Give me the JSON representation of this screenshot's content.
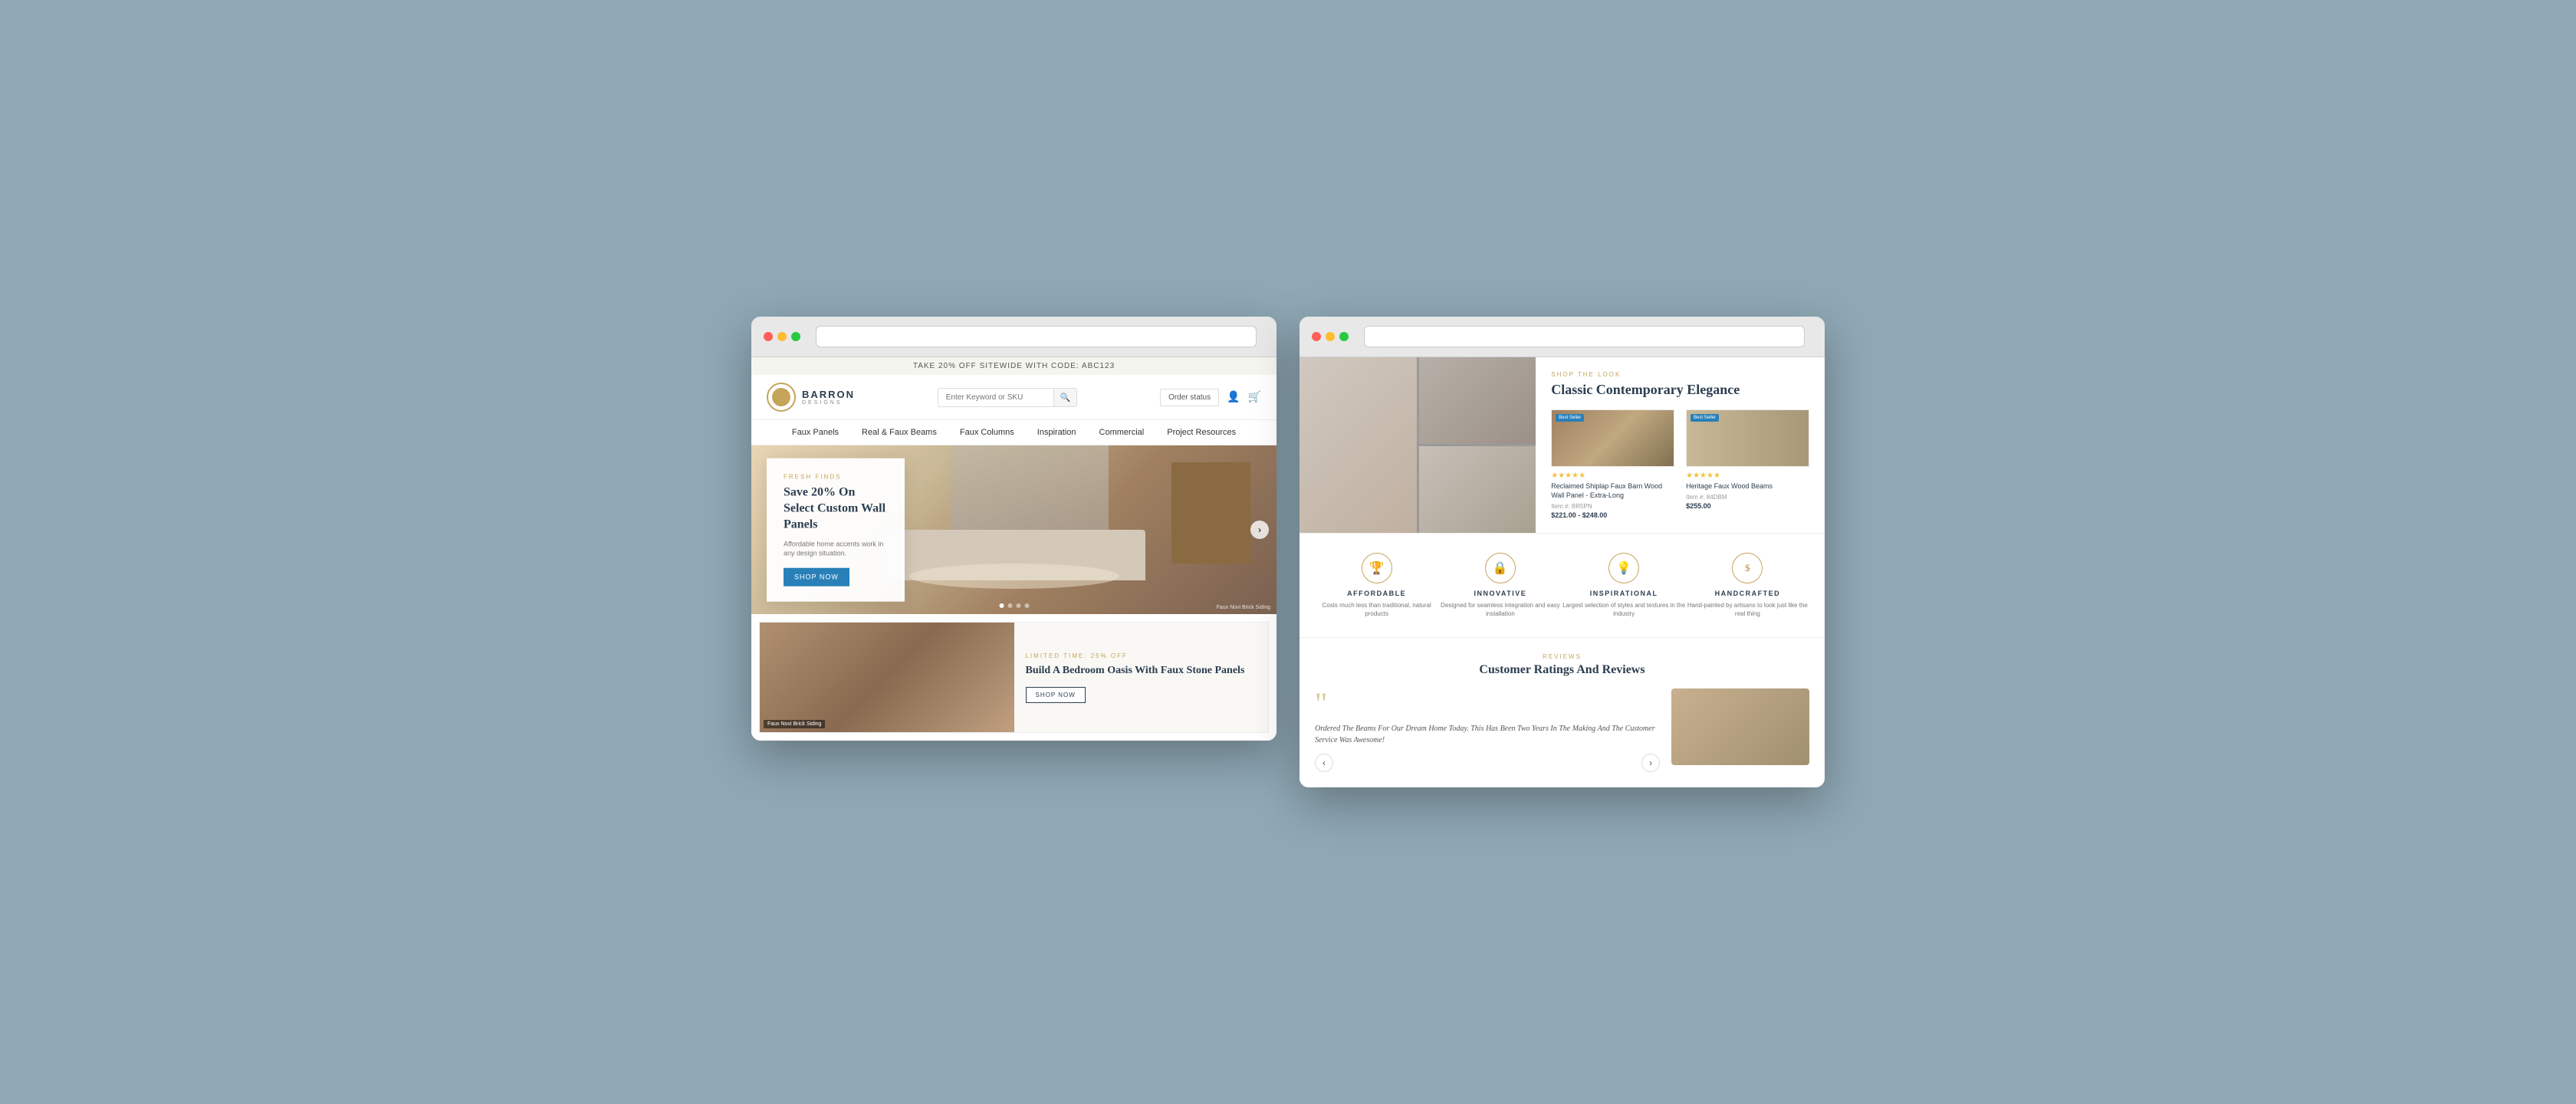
{
  "screen1": {
    "announcement": "TAKE 20% OFF SITEWIDE WITH CODE: ABC123",
    "logo": {
      "brand": "BARRON",
      "sub": "DESIGNS"
    },
    "search": {
      "placeholder": "Enter Keyword or SKU"
    },
    "order_status_label": "Order status",
    "nav_items": [
      "Faux Panels",
      "Real & Faux Beams",
      "Faux Columns",
      "Inspiration",
      "Commercial",
      "Project Resources"
    ],
    "hero": {
      "tag": "FRESH FINDS",
      "title": "Save 20% On Select Custom Wall Panels",
      "desc": "Affordable home accents work in any design situation.",
      "btn": "SHOP NOW",
      "caption": "Faux Novi Brick Siding",
      "dots": [
        true,
        false,
        false,
        false
      ]
    },
    "promo": {
      "tag": "LIMITED TIME: 25% OFF",
      "title": "Build A Bedroom Oasis With Faux Stone Panels",
      "btn": "SHOP NOW",
      "label": "Faux Novi Brick Siding"
    }
  },
  "screen2": {
    "shop_the_look": {
      "tag": "SHOP THE LOOK",
      "title": "Classic Contemporary Elegance",
      "products": [
        {
          "name": "Reclaimed Shiplap Faux Barn Wood Wall Panel - Extra-Long",
          "item": "Item #: BR5PN",
          "price_range": "$221.00 - $248.00",
          "badge": "Best Seller",
          "stars": "★★★★★"
        },
        {
          "name": "Heritage Faux Wood Beams",
          "item": "Item #: 84DBM",
          "price": "$255.00",
          "badge": "Best Seller",
          "stars": "★★★★★"
        }
      ]
    },
    "features": [
      {
        "icon": "🏆",
        "title": "AFFORDABLE",
        "desc": "Costs much less than traditional, natural products"
      },
      {
        "icon": "🔒",
        "title": "INNOVATIVE",
        "desc": "Designed for seamless integration and easy installation"
      },
      {
        "icon": "💡",
        "title": "INSPIRATIONAL",
        "desc": "Largest selection of styles and textures in the industry"
      },
      {
        "icon": "$",
        "title": "HANDCRAFTED",
        "desc": "Hand-painted by artisans to look just like the real thing"
      }
    ],
    "reviews": {
      "tag": "REVIEWS",
      "title": "Customer Ratings And Reviews",
      "quote": "Ordered The Beams For Our Dream Home Today. This Has Been Two Years In The Making And The Customer Service Was Awesome!"
    }
  }
}
